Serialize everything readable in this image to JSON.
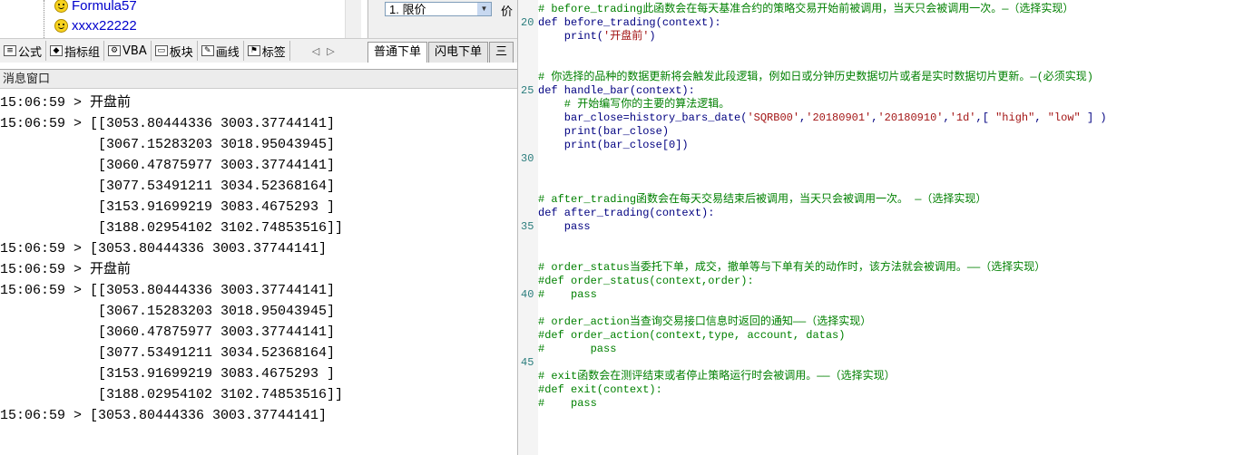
{
  "tree": {
    "items": [
      {
        "label": "Formula57"
      },
      {
        "label": "xxxx22222"
      }
    ]
  },
  "order_panel": {
    "type_value": "1. 限价",
    "price_label": "价"
  },
  "toolbar": {
    "buttons": [
      {
        "label": "公式",
        "icon": "formula-icon"
      },
      {
        "label": "指标组",
        "icon": "indicator-group-icon"
      },
      {
        "label": "VBA",
        "icon": "vba-icon"
      },
      {
        "label": "板块",
        "icon": "sector-icon"
      },
      {
        "label": "画线",
        "icon": "draw-line-icon"
      },
      {
        "label": "标签",
        "icon": "tag-icon"
      }
    ],
    "prev_arrow": "◁",
    "next_arrow": "▷"
  },
  "tabs": [
    {
      "label": "普通下单",
      "active": true
    },
    {
      "label": "闪电下单",
      "active": false
    },
    {
      "label": "三",
      "active": false
    }
  ],
  "message_window": {
    "title": "消息窗口",
    "lines": [
      "15:06:59 > 开盘前",
      "15:06:59 > [[3053.80444336 3003.37744141]",
      "            [3067.15283203 3018.95043945]",
      "            [3060.47875977 3003.37744141]",
      "            [3077.53491211 3034.52368164]",
      "            [3153.91699219 3083.4675293 ]",
      "            [3188.02954102 3102.74853516]]",
      "15:06:59 > [3053.80444336 3003.37744141]",
      "15:06:59 > 开盘前",
      "15:06:59 > [[3053.80444336 3003.37744141]",
      "            [3067.15283203 3018.95043945]",
      "            [3060.47875977 3003.37744141]",
      "            [3077.53491211 3034.52368164]",
      "            [3153.91699219 3083.4675293 ]",
      "            [3188.02954102 3102.74853516]]",
      "15:06:59 > [3053.80444336 3003.37744141]"
    ]
  },
  "editor": {
    "line_numbers": [
      "20",
      "25",
      "30",
      "35",
      "40",
      "45"
    ],
    "lines": [
      {
        "kind": "com",
        "text": "# before_trading此函数会在每天基准合约的策略交易开始前被调用，当天只会被调用一次。—（选择实现）"
      },
      {
        "kind": "def",
        "text": "def before_trading(context):"
      },
      {
        "kind": "code",
        "text": "    print('开盘前')"
      },
      {
        "kind": "blank",
        "text": ""
      },
      {
        "kind": "blank",
        "text": ""
      },
      {
        "kind": "com",
        "text": "# 你选择的品种的数据更新将会触发此段逻辑，例如日或分钟历史数据切片或者是实时数据切片更新。—(必须实现)"
      },
      {
        "kind": "def",
        "text": "def handle_bar(context):"
      },
      {
        "kind": "com",
        "text": "    # 开始编写你的主要的算法逻辑。"
      },
      {
        "kind": "code",
        "text": "    bar_close=history_bars_date('SQRB00','20180901','20180910','1d',[ \"high\", \"low\" ] )"
      },
      {
        "kind": "code",
        "text": "    print(bar_close)"
      },
      {
        "kind": "code",
        "text": "    print(bar_close[0])"
      },
      {
        "kind": "blank",
        "text": ""
      },
      {
        "kind": "blank",
        "text": ""
      },
      {
        "kind": "blank",
        "text": ""
      },
      {
        "kind": "com",
        "text": "# after_trading函数会在每天交易结束后被调用，当天只会被调用一次。 —（选择实现）"
      },
      {
        "kind": "def",
        "text": "def after_trading(context):"
      },
      {
        "kind": "code",
        "text": "    pass"
      },
      {
        "kind": "blank",
        "text": ""
      },
      {
        "kind": "blank",
        "text": ""
      },
      {
        "kind": "com",
        "text": "# order_status当委托下单，成交，撤单等与下单有关的动作时，该方法就会被调用。——（选择实现）"
      },
      {
        "kind": "com",
        "text": "#def order_status(context,order):"
      },
      {
        "kind": "com",
        "text": "#    pass"
      },
      {
        "kind": "blank",
        "text": ""
      },
      {
        "kind": "com",
        "text": "# order_action当查询交易接口信息时返回的通知——（选择实现）"
      },
      {
        "kind": "com",
        "text": "#def order_action(context,type, account, datas)"
      },
      {
        "kind": "com",
        "text": "#       pass"
      },
      {
        "kind": "blank",
        "text": ""
      },
      {
        "kind": "com",
        "text": "# exit函数会在测评结束或者停止策略运行时会被调用。——（选择实现）"
      },
      {
        "kind": "com",
        "text": "#def exit(context):"
      },
      {
        "kind": "com",
        "text": "#    pass"
      }
    ]
  }
}
